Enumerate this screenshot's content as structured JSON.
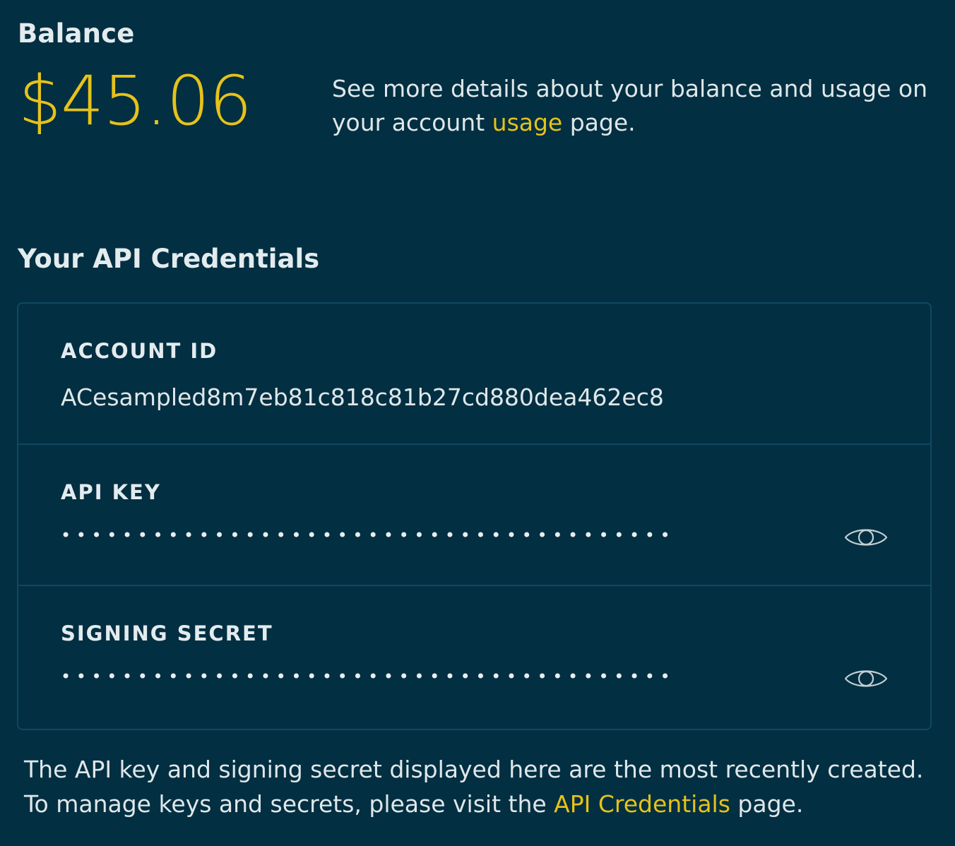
{
  "balance": {
    "label": "Balance",
    "amount": "$45.06",
    "note_before": "See more details about your balance and usage on your account ",
    "note_link": "usage",
    "note_after": " page."
  },
  "credentials": {
    "title": "Your API Credentials",
    "account_id": {
      "label": "ACCOUNT ID",
      "value": "ACesampled8m7eb81c818c81b27cd880dea462ec8"
    },
    "api_key": {
      "label": "API KEY",
      "masked_value": "••••••••••••••••••••••••••••••••••••••••",
      "reveal_icon": "eye-icon"
    },
    "signing_secret": {
      "label": "SIGNING SECRET",
      "masked_value": "••••••••••••••••••••••••••••••••••••••••",
      "reveal_icon": "eye-icon"
    }
  },
  "footer": {
    "note_before": "The API key and signing secret displayed here are the most recently created. To manage keys and secrets, please visit the ",
    "note_link": "API Credentials",
    "note_after": " page."
  },
  "colors": {
    "background": "#022f41",
    "accent": "#e6c21a",
    "text": "#dfe7ea",
    "border": "#0c4a60"
  }
}
